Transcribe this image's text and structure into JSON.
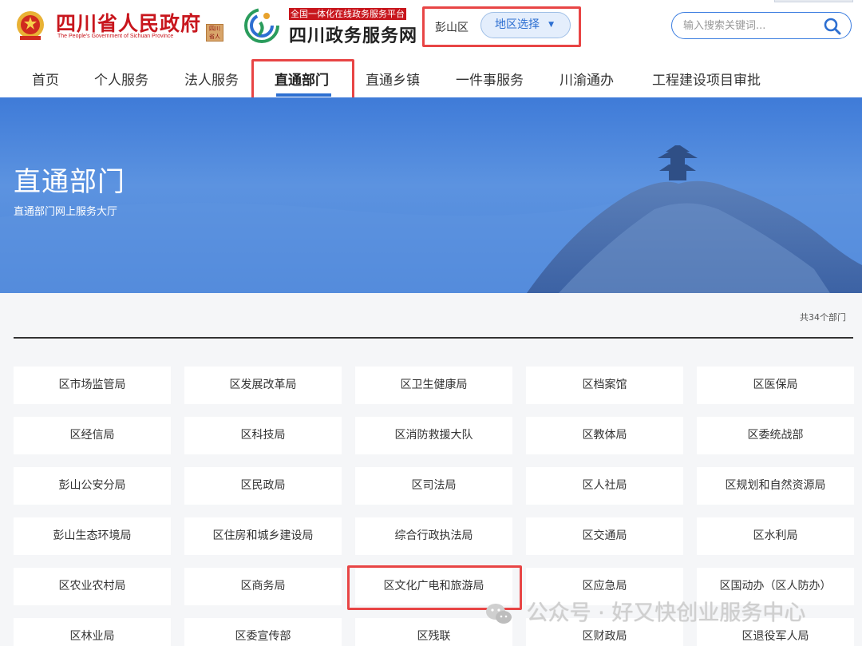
{
  "header": {
    "gov_name": "四川省人民政府",
    "gov_name_en": "The People's Government of Sichuan Province",
    "seal_text": "四川省人民政府",
    "service_tag": "全国一体化在线政务服务平台",
    "service_name": "四川政务服务网",
    "region_current": "彭山区",
    "region_select_label": "地区选择",
    "search_placeholder": "输入搜索关键词..."
  },
  "nav": {
    "items": [
      "首页",
      "个人服务",
      "法人服务",
      "直通部门",
      "直通乡镇",
      "一件事服务",
      "川渝通办",
      "工程建设项目审批"
    ],
    "active_index": 3
  },
  "banner": {
    "title": "直通部门",
    "subtitle": "直通部门网上服务大厅"
  },
  "departments": {
    "total_label": "共34个部门",
    "items": [
      "区市场监管局",
      "区发展改革局",
      "区卫生健康局",
      "区档案馆",
      "区医保局",
      "区经信局",
      "区科技局",
      "区消防救援大队",
      "区教体局",
      "区委统战部",
      "彭山公安分局",
      "区民政局",
      "区司法局",
      "区人社局",
      "区规划和自然资源局",
      "彭山生态环境局",
      "区住房和城乡建设局",
      "综合行政执法局",
      "区交通局",
      "区水利局",
      "区农业农村局",
      "区商务局",
      "区文化广电和旅游局",
      "区应急局",
      "区国动办（区人防办）",
      "区林业局",
      "区委宣传部",
      "区残联",
      "区财政局",
      "区退役军人局"
    ],
    "highlighted_index": 22
  },
  "watermark": {
    "text": "公众号 · 好又快创业服务中心"
  },
  "colors": {
    "gov_red": "#c8161d",
    "brand_blue": "#2d6fd1",
    "highlight_red": "#e84545",
    "banner_blue": "#4b84d8"
  },
  "icons": {
    "emblem": "national-emblem-icon",
    "service_logo": "sichuan-service-logo-icon",
    "search": "search-icon",
    "dropdown": "caret-down-icon",
    "watermark": "wechat-icon"
  }
}
